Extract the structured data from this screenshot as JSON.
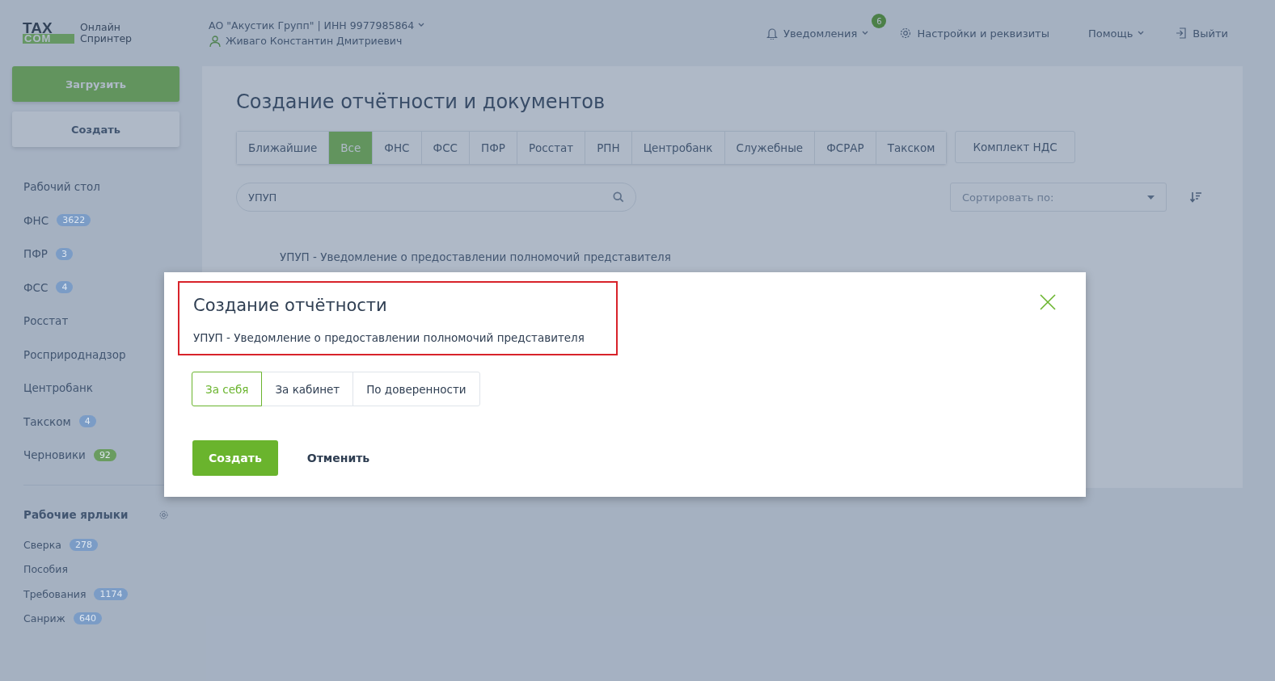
{
  "header": {
    "logo": {
      "top": "TAX",
      "bottom": "COM",
      "line1": "Онлайн",
      "line2": "Спринтер"
    },
    "org": "АО \"Акустик Групп\" | ИНН 9977985864",
    "user": "Живаго Константин Дмитриевич",
    "nav": [
      {
        "kind": "notifications",
        "label": "Уведомления",
        "badge": "6",
        "dropdown": true
      },
      {
        "kind": "settings",
        "label": "Настройки и реквизиты",
        "dropdown": false
      },
      {
        "kind": "help",
        "label": "Помощь",
        "dropdown": true
      },
      {
        "kind": "logout",
        "label": "Выйти",
        "dropdown": false
      }
    ]
  },
  "sidebar": {
    "upload_button": "Загрузить",
    "create_button": "Создать",
    "items": [
      {
        "label": "Рабочий стол"
      },
      {
        "label": "ФНС",
        "badge": "3622",
        "color": "#7b9cc6"
      },
      {
        "label": "ПФР",
        "badge": "3",
        "color": "#7b9cc6"
      },
      {
        "label": "ФСС",
        "badge": "4",
        "color": "#7b9cc6"
      },
      {
        "label": "Росстат"
      },
      {
        "label": "Росприроднадзор"
      },
      {
        "label": "Центробанк"
      },
      {
        "label": "Такском",
        "badge": "4",
        "color": "#7b9cc6"
      },
      {
        "label": "Черновики",
        "badge": "92",
        "color": "#6a9c60"
      }
    ],
    "shortcuts": {
      "title": "Рабочие ярлыки",
      "items": [
        {
          "label": "Сверка",
          "badge": "278"
        },
        {
          "label": "Пособия"
        },
        {
          "label": "Требования",
          "badge": "1174"
        },
        {
          "label": "Санриж",
          "badge": "640"
        }
      ]
    }
  },
  "main": {
    "title": "Создание отчётности и документов",
    "tabs": [
      {
        "label": "Ближайшие",
        "selected": false
      },
      {
        "label": "Все",
        "selected": true
      },
      {
        "label": "ФНС",
        "selected": false
      },
      {
        "label": "ФСС",
        "selected": false
      },
      {
        "label": "ПФР",
        "selected": false
      },
      {
        "label": "Росстат",
        "selected": false
      },
      {
        "label": "РПН",
        "selected": false
      },
      {
        "label": "Центробанк",
        "selected": false
      },
      {
        "label": "Служебные",
        "selected": false
      },
      {
        "label": "ФСРАР",
        "selected": false
      },
      {
        "label": "Такском",
        "selected": false
      }
    ],
    "extra_tab": "Комплект НДС",
    "search": {
      "value": "УПУП"
    },
    "sort": {
      "placeholder": "Сортировать по:"
    },
    "results": [
      "УПУП - Уведомление о предоставлении полномочий представителя"
    ]
  },
  "modal": {
    "title": "Создание отчётности",
    "subtitle": "УПУП - Уведомление о предоставлении полномочий представителя",
    "highlighted": true,
    "options": [
      {
        "label": "За себя",
        "selected": true
      },
      {
        "label": "За кабинет",
        "selected": false
      },
      {
        "label": "По доверенности",
        "selected": false
      }
    ],
    "primary_button": "Создать",
    "secondary_button": "Отменить"
  }
}
